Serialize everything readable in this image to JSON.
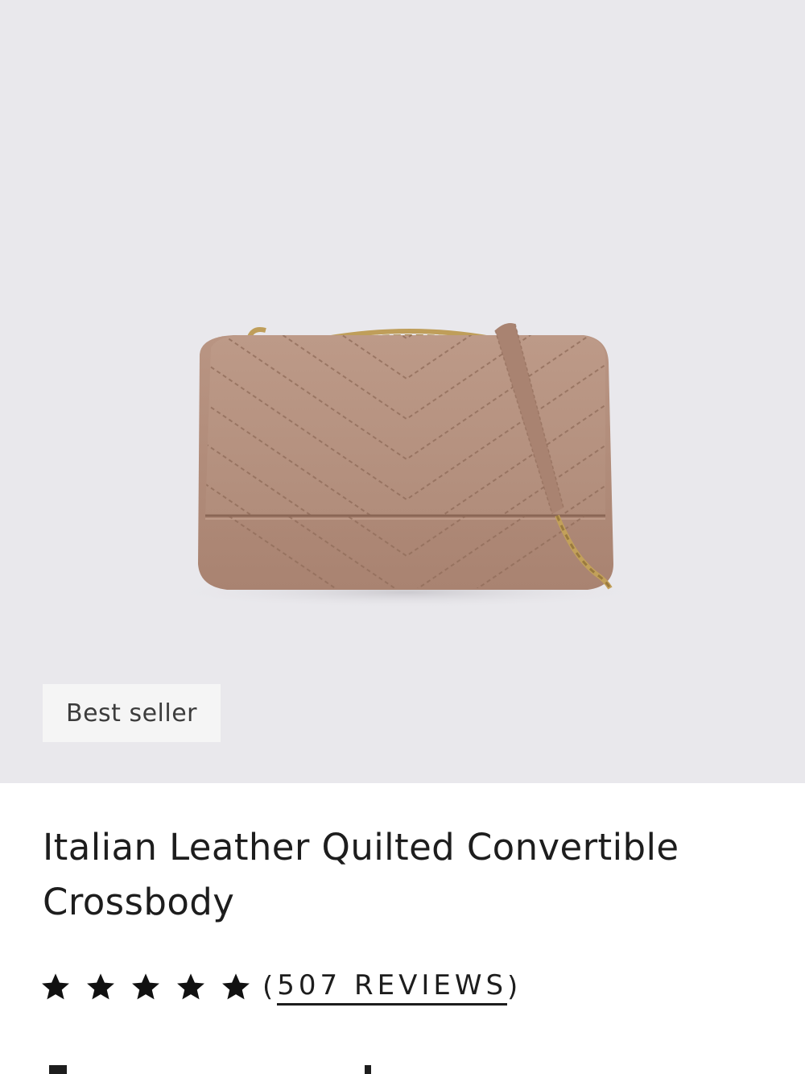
{
  "product": {
    "badge": "Best seller",
    "title": "Italian Leather Quilted Convertible Crossbody",
    "image_icon": "quilted-crossbody-bag-image",
    "colors": {
      "background": "#e9e8ec",
      "leather": "#b48f7d",
      "hardware": "#c2a05a"
    }
  },
  "rating": {
    "stars": 5,
    "max": 5,
    "open_paren": "(",
    "reviews_label": "507 REVIEWS",
    "close_paren": ")",
    "star_icon": "star-icon"
  }
}
